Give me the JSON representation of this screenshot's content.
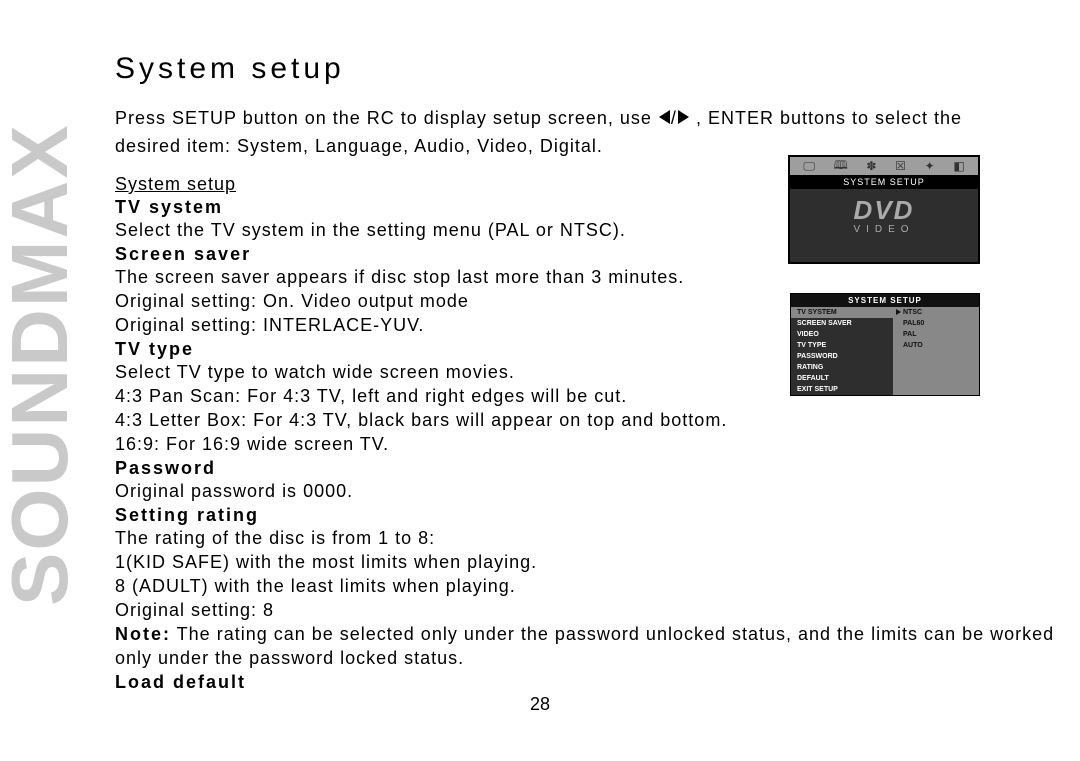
{
  "brand": "SOUNDMAX",
  "title": "System setup",
  "intro_part1": "Press SETUP button on the RC to display setup screen, use ",
  "intro_part2": ", ENTER buttons to select the desired item: System, Language, Audio, Video, Digital.",
  "section_header": "System setup",
  "tv_system_label": "TV system",
  "tv_system_body": "Select the TV system in the setting menu (PAL or NTSC).",
  "screen_saver_label": "Screen saver",
  "screen_saver_body1": "The screen saver appears if disc stop last more than 3 minutes.",
  "screen_saver_body2": "Original setting: On. Video output mode",
  "screen_saver_body3": "Original setting: INTERLACE-YUV.",
  "tv_type_label": "TV type",
  "tv_type_body1": "Select TV type to watch wide screen movies.",
  "tv_type_body2": "4:3 Pan Scan: For 4:3 TV, left and right edges will be cut.",
  "tv_type_body3": "4:3 Letter Box: For 4:3 TV, black bars will appear on top and bottom.",
  "tv_type_body4": "16:9: For 16:9 wide screen TV.",
  "password_label": "Password",
  "password_body": "Original password is 0000.",
  "rating_label": "Setting rating",
  "rating_body1": "The rating of the disc is from 1 to 8:",
  "rating_body2": "1(KID SAFE) with the most limits when playing.",
  "rating_body3": "8 (ADULT) with the least limits when playing.",
  "rating_body4": "Original setting: 8",
  "note_label": "Note:",
  "note_body": " The rating can be selected only under the password unlocked status, and the limits can be worked only under the password locked status.",
  "load_default_label": "Load default",
  "page_number": "28",
  "osd1": {
    "title": "SYSTEM SETUP",
    "dvd": "DVD",
    "video": "VIDEO"
  },
  "osd2": {
    "title": "SYSTEM SETUP",
    "rows": [
      {
        "left": "TV SYSTEM",
        "right": "NTSC",
        "selected": true,
        "arrow": true
      },
      {
        "left": "SCREEN SAVER",
        "right": "PAL60"
      },
      {
        "left": "VIDEO",
        "right": "PAL"
      },
      {
        "left": "TV TYPE",
        "right": "AUTO"
      },
      {
        "left": "PASSWORD",
        "right": ""
      },
      {
        "left": "RATING",
        "right": ""
      },
      {
        "left": "DEFAULT",
        "right": ""
      },
      {
        "left": "EXIT  SETUP",
        "right": ""
      }
    ]
  }
}
